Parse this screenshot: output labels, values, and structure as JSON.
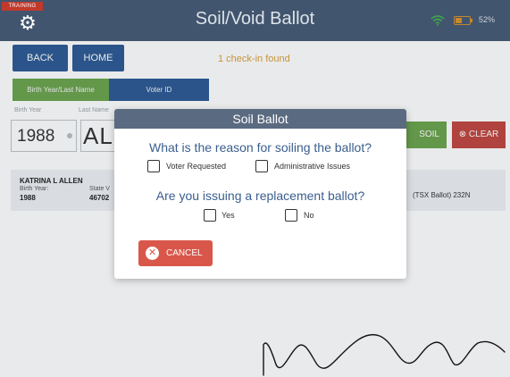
{
  "header": {
    "training_badge": "TRAINING",
    "title": "Soil/Void Ballot",
    "battery_percent": "52%"
  },
  "nav": {
    "back_label": "BACK",
    "home_label": "HOME",
    "status_text": "1 check-in found"
  },
  "search": {
    "tabs": [
      "Birth Year/Last Name",
      "Voter ID"
    ],
    "birth_year_label": "Birth Year",
    "last_name_label": "Last Name",
    "birth_year_value": "1988",
    "last_name_value": "ALL",
    "soil_label": "SOIL",
    "clear_label": "CLEAR"
  },
  "result": {
    "name": "KATRINA L ALLEN",
    "birth_year_label": "Birth Year:",
    "birth_year_value": "1988",
    "state_label": "State V",
    "state_value": "46702",
    "ballot": "(TSX Ballot) 232N"
  },
  "modal": {
    "title": "Soil Ballot",
    "question_1": "What is the reason for soiling the ballot?",
    "reason_options": [
      "Voter Requested",
      "Administrative Issues"
    ],
    "question_2": "Are you issuing a replacement ballot?",
    "replacement_options": [
      "Yes",
      "No"
    ],
    "cancel_label": "CANCEL"
  },
  "colors": {
    "topbar": "#42556e",
    "primary_button": "#2c5a93",
    "soil_button": "#6aa34c",
    "danger": "#c0463f",
    "question_text": "#3a5e8e"
  }
}
